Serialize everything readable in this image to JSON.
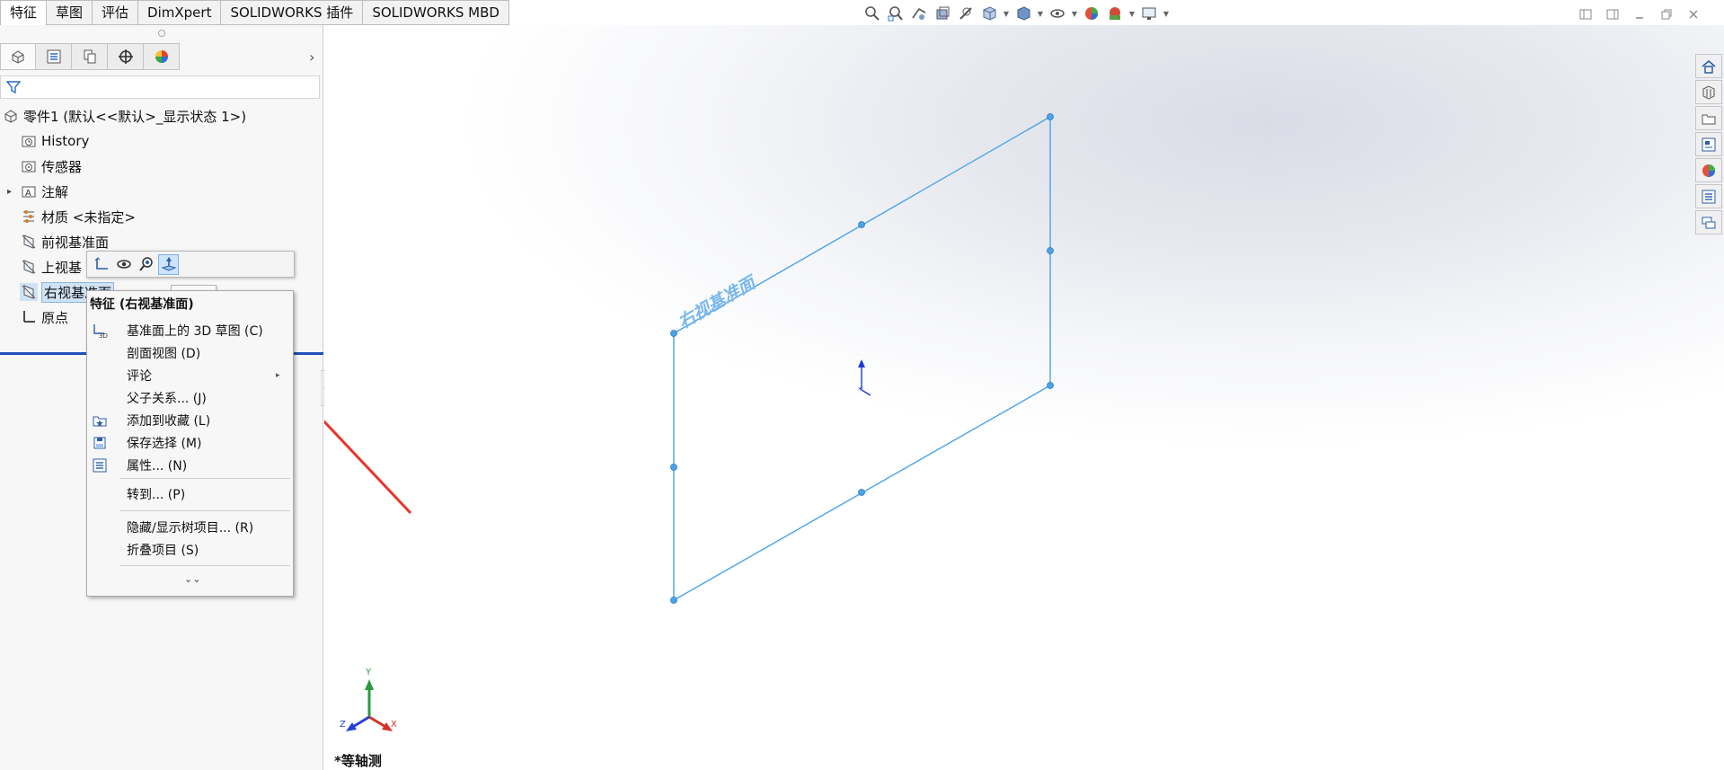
{
  "tabs": [
    "特征",
    "草图",
    "评估",
    "DimXpert",
    "SOLIDWORKS 插件",
    "SOLIDWORKS MBD"
  ],
  "tree": {
    "root": "零件1 (默认<<默认>_显示状态 1>)",
    "items": [
      {
        "label": "History",
        "icon": "history-folder-icon"
      },
      {
        "label": "传感器",
        "icon": "sensor-folder-icon"
      },
      {
        "label": "注解",
        "icon": "annotation-folder-icon"
      },
      {
        "label": "材质 <未指定>",
        "icon": "material-icon"
      },
      {
        "label": "前视基准面",
        "icon": "plane-icon"
      },
      {
        "label": "上视基",
        "icon": "plane-icon"
      },
      {
        "label": "右视基准面",
        "icon": "plane-icon"
      },
      {
        "label": "原点",
        "icon": "origin-icon"
      }
    ]
  },
  "context_toolbar": {
    "tooltip": "正视于"
  },
  "context_menu": {
    "header": "特征 (右视基准面)",
    "items": [
      {
        "label": "基准面上的 3D 草图 (C)",
        "icon": "3d-sketch-icon"
      },
      {
        "label": "剖面视图 (D)",
        "icon": ""
      },
      {
        "label": "评论",
        "icon": "",
        "submenu": true
      },
      {
        "label": "父子关系... (J)",
        "icon": ""
      },
      {
        "label": "添加到收藏 (L)",
        "icon": "favorite-folder-icon"
      },
      {
        "label": "保存选择 (M)",
        "icon": "save-selection-icon"
      },
      {
        "label": "属性... (N)",
        "icon": "properties-icon"
      },
      {
        "label": "转到... (P)",
        "icon": ""
      },
      {
        "label": "隐藏/显示树项目... (R)",
        "icon": ""
      },
      {
        "label": "折叠项目 (S)",
        "icon": ""
      }
    ]
  },
  "viewport": {
    "plane_label": "右视基准面",
    "view_name": "*等轴测",
    "triad": {
      "x": "X",
      "y": "Y",
      "z": "Z"
    }
  },
  "colors": {
    "plane": "#4aa3e8",
    "arrow": "#e8342a",
    "rollback_bar": "#1f4fb8"
  }
}
